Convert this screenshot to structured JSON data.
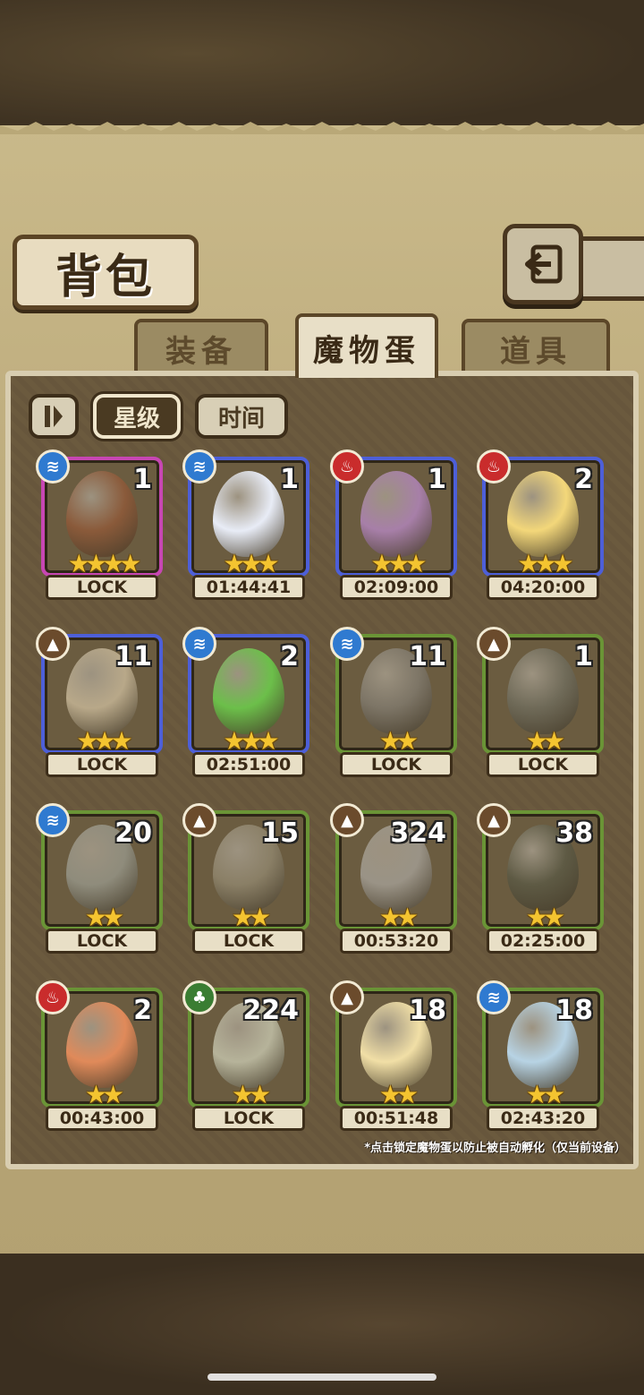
{
  "title": "背包",
  "tabs": [
    {
      "label": "装备",
      "active": false
    },
    {
      "label": "魔物蛋",
      "active": true
    },
    {
      "label": "道具",
      "active": false
    }
  ],
  "sort": {
    "toggle_icon": "sort-toggle-icon",
    "buttons": [
      {
        "label": "星级",
        "active": true
      },
      {
        "label": "时间",
        "active": false
      }
    ]
  },
  "eggs": [
    {
      "count": "1",
      "stars": 4,
      "element": "water",
      "rarity": "pink",
      "status": "LOCK",
      "color": "#8a5a3a"
    },
    {
      "count": "1",
      "stars": 3,
      "element": "water",
      "rarity": "blue",
      "status": "01:44:41",
      "color": "#e8ecf6"
    },
    {
      "count": "1",
      "stars": 3,
      "element": "fire",
      "rarity": "blue",
      "status": "02:09:00",
      "color": "#a77fa8"
    },
    {
      "count": "2",
      "stars": 3,
      "element": "fire",
      "rarity": "blue",
      "status": "04:20:00",
      "color": "#f3d77a"
    },
    {
      "count": "11",
      "stars": 3,
      "element": "earth",
      "rarity": "blue",
      "status": "LOCK",
      "color": "#b8a889"
    },
    {
      "count": "2",
      "stars": 3,
      "element": "water",
      "rarity": "blue",
      "status": "02:51:00",
      "color": "#6cbf4a"
    },
    {
      "count": "11",
      "stars": 2,
      "element": "water",
      "rarity": "green",
      "status": "LOCK",
      "color": "#7d7566"
    },
    {
      "count": "1",
      "stars": 2,
      "element": "earth",
      "rarity": "green",
      "status": "LOCK",
      "color": "#6f6a58"
    },
    {
      "count": "20",
      "stars": 2,
      "element": "water",
      "rarity": "green",
      "status": "LOCK",
      "color": "#8f8c7c"
    },
    {
      "count": "15",
      "stars": 2,
      "element": "earth",
      "rarity": "green",
      "status": "LOCK",
      "color": "#8a7f66"
    },
    {
      "count": "324",
      "stars": 2,
      "element": "earth",
      "rarity": "green",
      "status": "00:53:20",
      "color": "#9a9386"
    },
    {
      "count": "38",
      "stars": 2,
      "element": "earth",
      "rarity": "green",
      "status": "02:25:00",
      "color": "#5e5a44"
    },
    {
      "count": "2",
      "stars": 2,
      "element": "fire",
      "rarity": "green",
      "status": "00:43:00",
      "color": "#e08a5a"
    },
    {
      "count": "224",
      "stars": 2,
      "element": "grass",
      "rarity": "green",
      "status": "LOCK",
      "color": "#b6b39a"
    },
    {
      "count": "18",
      "stars": 2,
      "element": "earth",
      "rarity": "green",
      "status": "00:51:48",
      "color": "#f1dfa6"
    },
    {
      "count": "18",
      "stars": 2,
      "element": "water",
      "rarity": "green",
      "status": "02:43:20",
      "color": "#b7d3e4"
    }
  ],
  "note": "*点击锁定魔物蛋以防止被自动孵化（仅当前设备）"
}
